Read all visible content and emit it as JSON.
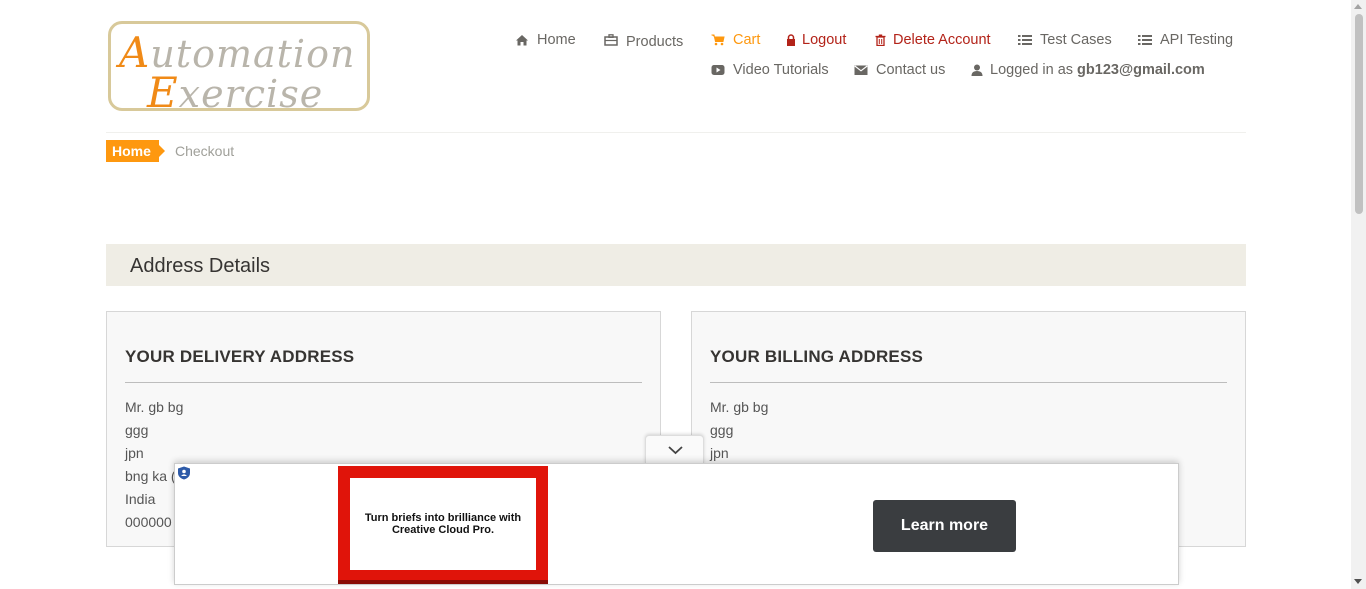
{
  "logo": {
    "line1_cap": "A",
    "line1_rest": "utomation",
    "line2_cap": "E",
    "line2_rest": "xercise"
  },
  "nav": {
    "home": "Home",
    "products": "Products",
    "cart": "Cart",
    "logout": "Logout",
    "delete_account": "Delete Account",
    "test_cases": "Test Cases",
    "api_testing": "API Testing",
    "video_tutorials": "Video Tutorials",
    "contact_us": "Contact us",
    "logged_in_prefix": "Logged in as",
    "logged_in_user": "gb123@gmail.com"
  },
  "breadcrumb": {
    "home": "Home",
    "current": "Checkout"
  },
  "section_title": "Address Details",
  "delivery": {
    "heading": "YOUR DELIVERY ADDRESS",
    "lines": [
      "Mr. gb bg",
      "ggg",
      "jpn",
      "bng ka (",
      "India",
      "000000"
    ]
  },
  "billing": {
    "heading": "YOUR BILLING ADDRESS",
    "lines": [
      "Mr. gb bg",
      "ggg",
      "jpn"
    ]
  },
  "ad": {
    "creative_text": "Turn briefs into brilliance with Creative Cloud Pro.",
    "cta": "Learn more"
  },
  "colors": {
    "accent": "#fe980f",
    "danger": "#b32319",
    "text": "#696763"
  },
  "icons": {
    "home": "home-icon",
    "products": "briefcase-icon",
    "cart": "cart-icon",
    "logout": "lock-icon",
    "delete_account": "trash-icon",
    "test_cases": "list-icon",
    "api_testing": "list-icon",
    "video_tutorials": "youtube-play-icon",
    "contact_us": "envelope-icon",
    "logged_in": "user-icon",
    "ad_toggle": "chevron-down-icon",
    "ad_info": "shield-icon"
  }
}
